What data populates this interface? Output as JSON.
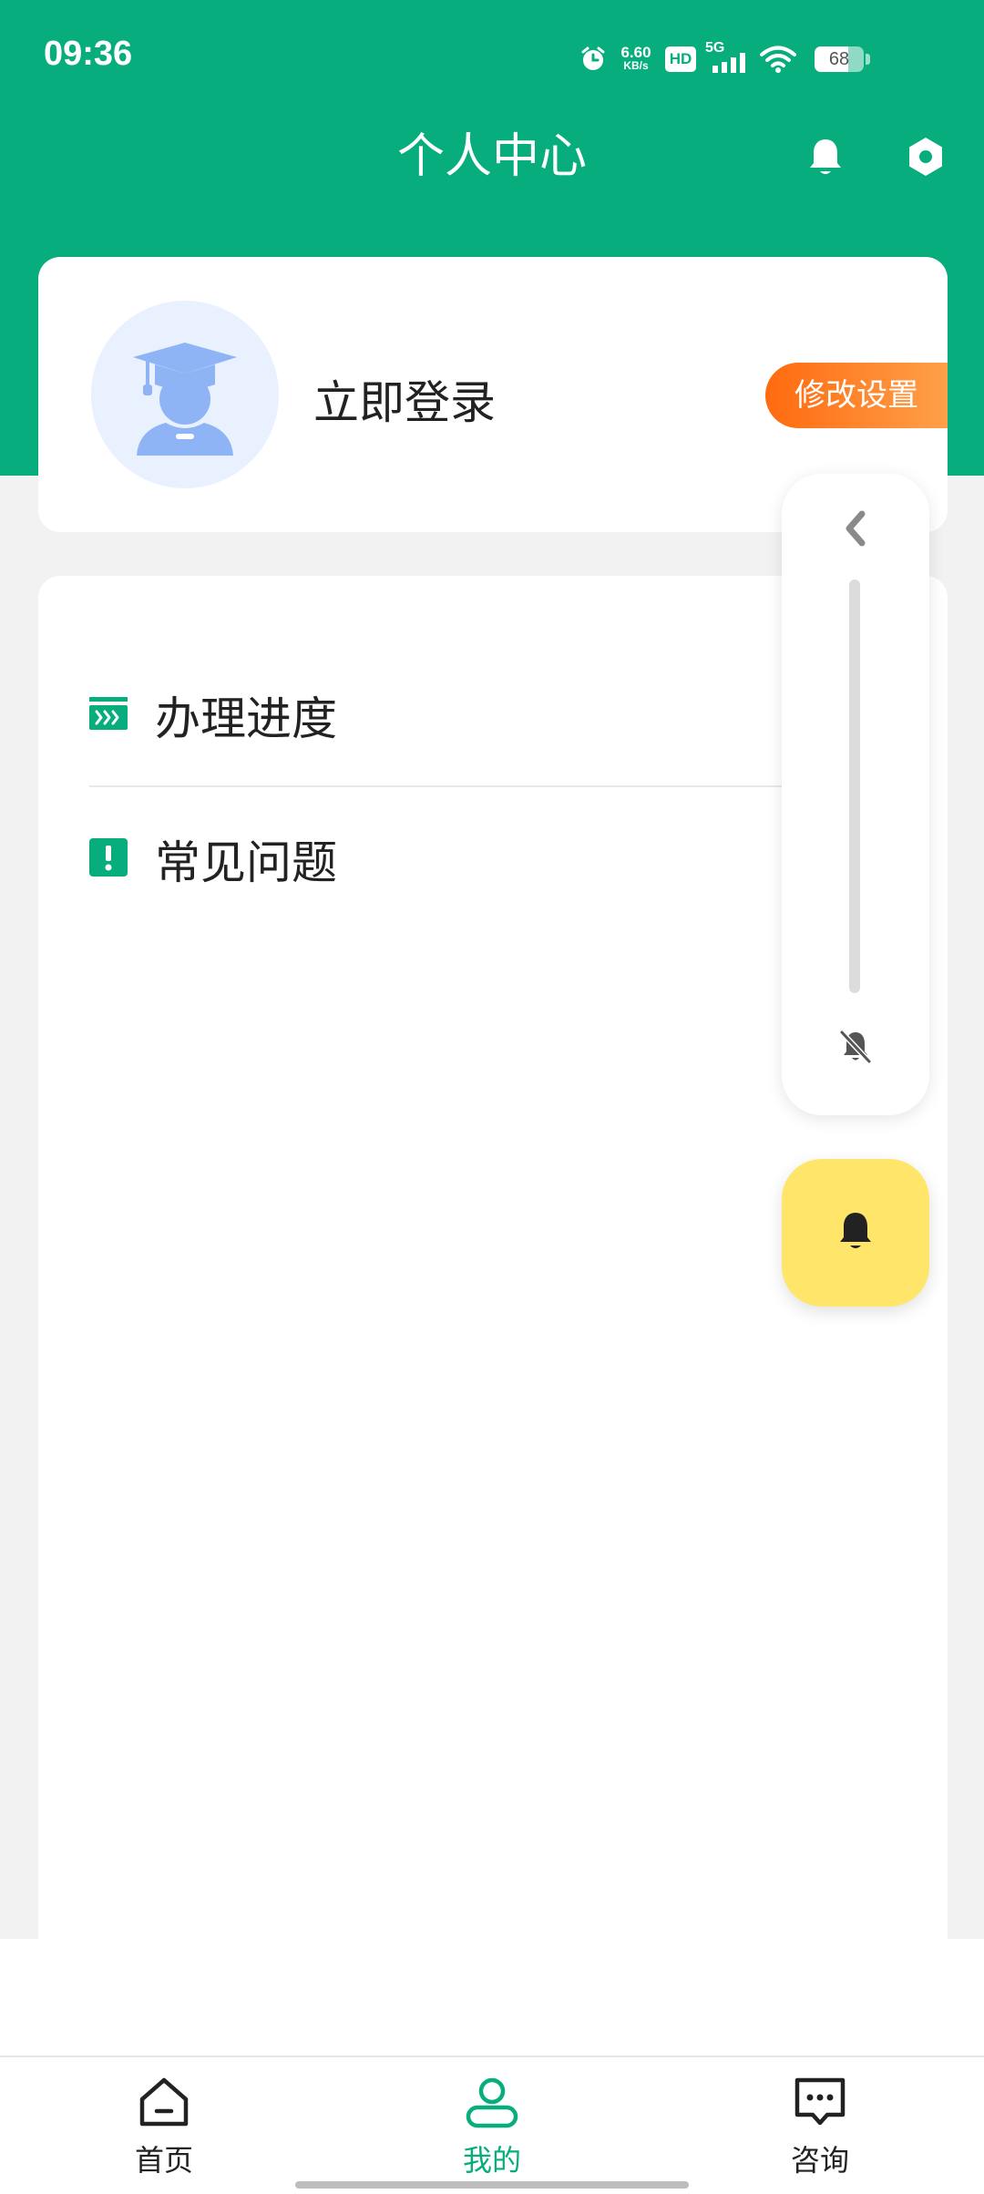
{
  "status_bar": {
    "time": "09:36",
    "net_speed_value": "6.60",
    "net_speed_unit": "KB/s",
    "hd_label": "HD",
    "network_label": "5G",
    "battery_level": "68",
    "battery_fraction": 0.68,
    "icons": [
      "alarm-icon",
      "hd-icon",
      "cellular-signal-icon",
      "wifi-icon",
      "battery-icon"
    ]
  },
  "header": {
    "title": "个人中心",
    "icons": [
      "notification-bell-icon",
      "settings-hexagon-icon"
    ]
  },
  "profile": {
    "login_label": "立即登录",
    "settings_button": "修改设置",
    "avatar_icon": "graduate-avatar-icon"
  },
  "menu": {
    "items": [
      {
        "label": "办理进度",
        "icon": "progress-arrows-icon"
      },
      {
        "label": "常见问题",
        "icon": "exclamation-icon"
      }
    ]
  },
  "volume_panel": {
    "level": 0,
    "icons": [
      "chevron-left-icon",
      "muted-icon"
    ]
  },
  "ring_button": {
    "icon": "bell-icon"
  },
  "bottom_nav": {
    "items": [
      {
        "label": "首页",
        "icon": "home-icon",
        "active": false
      },
      {
        "label": "我的",
        "icon": "user-icon",
        "active": true
      },
      {
        "label": "咨询",
        "icon": "chat-icon",
        "active": false
      }
    ]
  },
  "colors": {
    "brand_green": "#07ad7d",
    "settings_orange": "#ff7a1a",
    "ring_yellow": "#ffe66b",
    "avatar_blue": "#8fb4f5"
  }
}
